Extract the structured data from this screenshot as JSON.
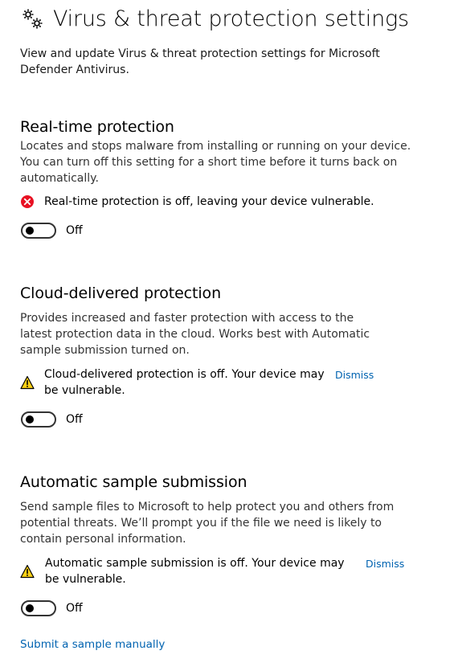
{
  "page": {
    "title": "Virus & threat protection settings",
    "intro": "View and update Virus & threat protection settings for Microsoft Defender Antivirus."
  },
  "sections": [
    {
      "title": "Real-time protection",
      "description": "Locates and stops malware from installing or running on your device. You can turn off this setting for a short time before it turns back on automatically.",
      "status_text": "Real-time protection is off, leaving your device vulnerable.",
      "status_icon": "error-icon",
      "toggle_state": "Off"
    },
    {
      "title": "Cloud-delivered protection",
      "description": "Provides increased and faster protection with access to the latest protection data in the cloud. Works best with Automatic sample submission turned on.",
      "status_text": "Cloud-delivered protection is off. Your device may be vulnerable.",
      "status_icon": "warning-icon",
      "dismiss_label": "Dismiss",
      "toggle_state": "Off"
    },
    {
      "title": "Automatic sample submission",
      "description": "Send sample files to Microsoft to help protect you and others from potential threats. We’ll prompt you if the file we need is likely to contain personal information.",
      "status_text": "Automatic sample submission is off. Your device may be vulnerable.",
      "status_icon": "warning-icon",
      "dismiss_label": "Dismiss",
      "toggle_state": "Off"
    }
  ],
  "footer": {
    "submit_link": "Submit a sample manually"
  },
  "colors": {
    "link": "#0063b1",
    "error": "#e81123",
    "warning": "#fcd116"
  }
}
